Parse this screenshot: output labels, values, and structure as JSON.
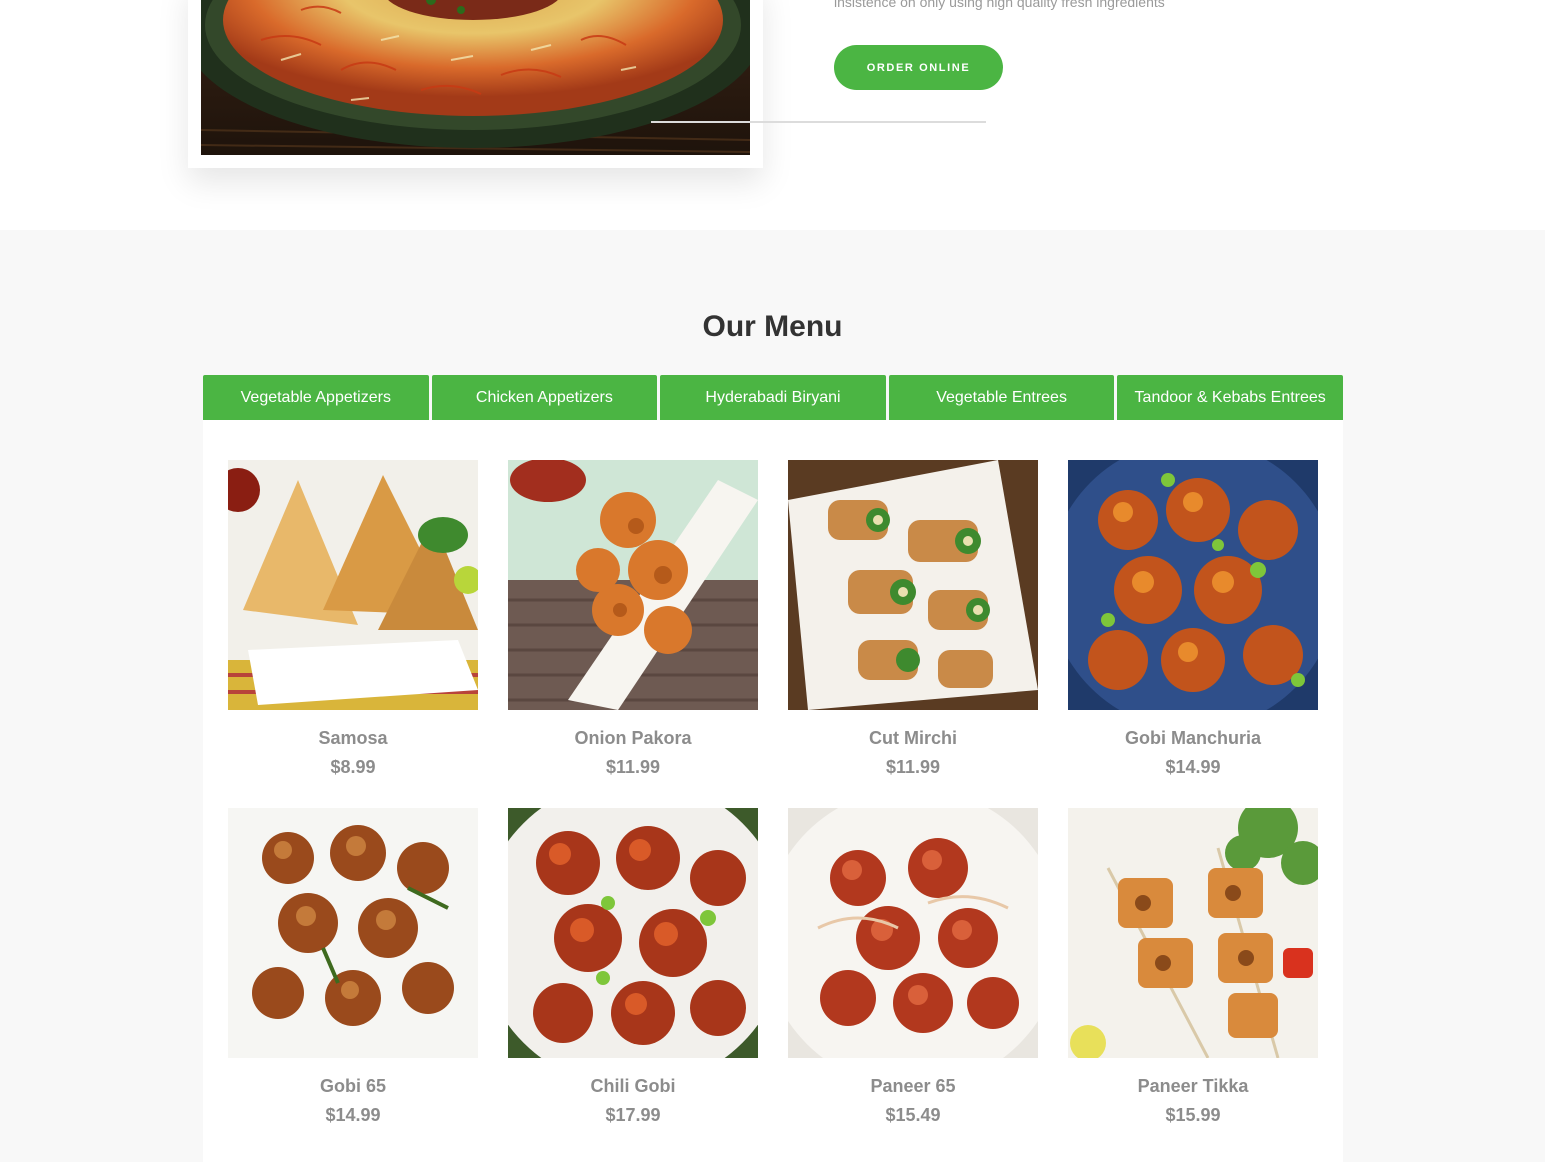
{
  "hero": {
    "text": "insistence on only using high quality fresh ingredients",
    "order_button": "ORDER ONLINE",
    "photo_name": "biryani-photo"
  },
  "menu": {
    "title": "Our Menu",
    "tabs": [
      {
        "label": "Vegetable Appetizers",
        "active": true
      },
      {
        "label": "Chicken Appetizers"
      },
      {
        "label": "Hyderabadi Biryani"
      },
      {
        "label": "Vegetable Entrees"
      },
      {
        "label": "Tandoor & Kebabs Entrees"
      }
    ],
    "items": [
      {
        "name": "Samosa",
        "price": "$8.99"
      },
      {
        "name": "Onion Pakora",
        "price": "$11.99"
      },
      {
        "name": "Cut Mirchi",
        "price": "$11.99"
      },
      {
        "name": "Gobi Manchuria",
        "price": "$14.99"
      },
      {
        "name": "Gobi 65",
        "price": "$14.99"
      },
      {
        "name": "Chili Gobi",
        "price": "$17.99"
      },
      {
        "name": "Paneer 65",
        "price": "$15.49"
      },
      {
        "name": "Paneer Tikka",
        "price": "$15.99"
      }
    ]
  },
  "colors": {
    "accent": "#4bb543",
    "section_bg": "#f8f8f8",
    "text_muted": "#8c8c8c",
    "title": "#333333"
  }
}
